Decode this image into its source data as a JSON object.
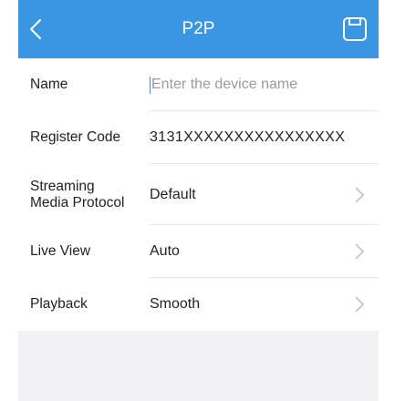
{
  "header": {
    "title": "P2P",
    "back_icon": "chevron-left-icon",
    "save_icon": "save-icon",
    "color": "#3a96e0"
  },
  "form": {
    "name": {
      "label": "Name",
      "placeholder": "Enter the device name",
      "value": ""
    },
    "register_code": {
      "label": "Register Code",
      "value": "3131XXXXXXXXXXXXXXXX"
    },
    "streaming_media_protocol": {
      "label_line1": "Streaming",
      "label_line2": "Media Protocol",
      "value": "Default"
    },
    "live_view": {
      "label": "Live View",
      "value": "Auto"
    },
    "playback": {
      "label": "Playback",
      "value": "Smooth"
    }
  }
}
